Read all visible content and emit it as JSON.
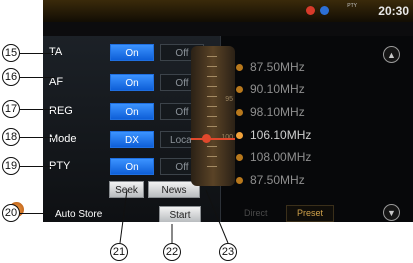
{
  "status": {
    "time": "20:30",
    "pty_text": "PTY"
  },
  "settings": {
    "rows": [
      {
        "label": "TA",
        "left": "On",
        "right": "Off",
        "selected": "left"
      },
      {
        "label": "AF",
        "left": "On",
        "right": "Off",
        "selected": "left"
      },
      {
        "label": "REG",
        "left": "On",
        "right": "Off",
        "selected": "left"
      },
      {
        "label": "Mode",
        "left": "DX",
        "right": "Local",
        "selected": "left"
      },
      {
        "label": "PTY",
        "left": "On",
        "right": "Off",
        "selected": "left"
      }
    ],
    "seek_label": "Seek",
    "news_label": "News",
    "auto_store_label": "Auto Store",
    "start_label": "Start"
  },
  "frequencies": [
    "87.50MHz",
    "90.10MHz",
    "98.10MHz",
    "106.10MHz",
    "108.00MHz",
    "87.50MHz"
  ],
  "selected_frequency_index": 3,
  "tabs": {
    "direct": "Direct",
    "preset": "Preset"
  },
  "dial": {
    "labels": [
      "95",
      "100"
    ]
  },
  "callouts": [
    "15",
    "16",
    "17",
    "18",
    "19",
    "20",
    "21",
    "22",
    "23"
  ],
  "colors": {
    "on": "#1f6fe0",
    "accent": "#f3a23a",
    "indicator": "#e0482c"
  }
}
